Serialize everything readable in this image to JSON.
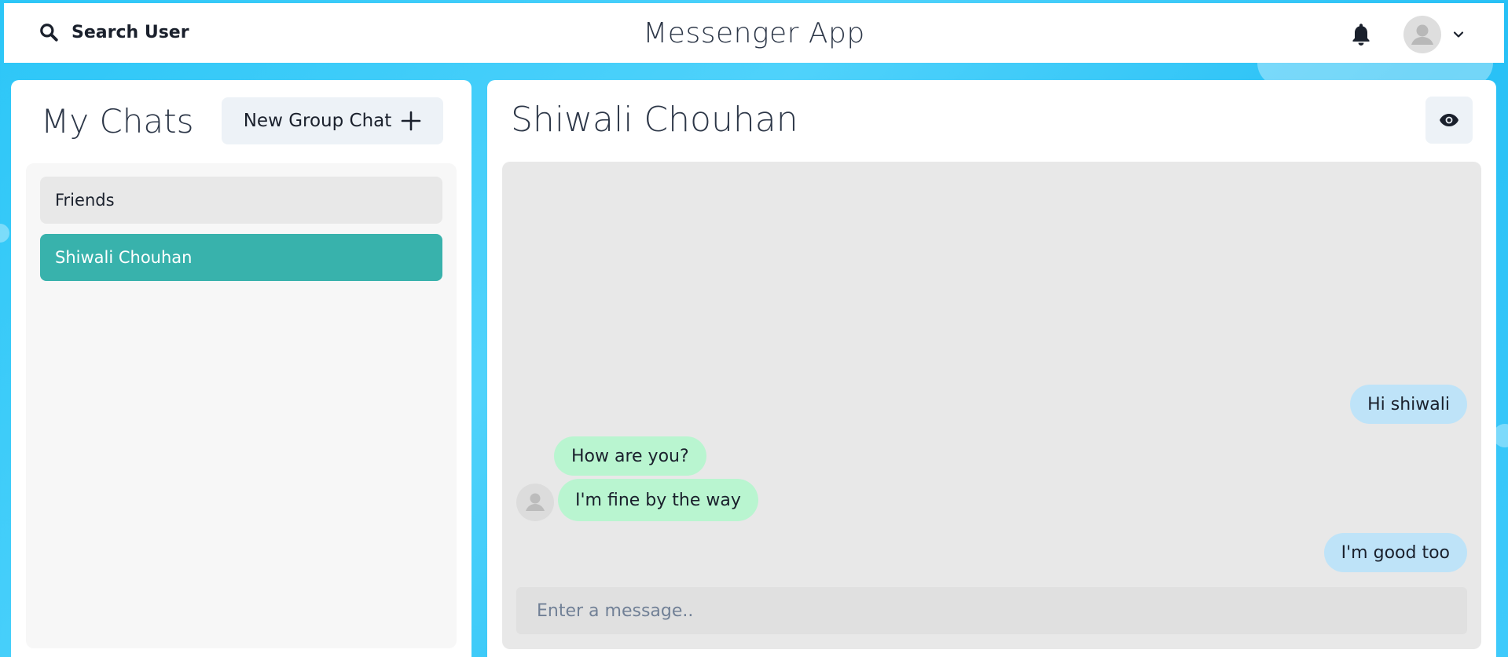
{
  "topbar": {
    "search_label": "Search User",
    "app_title": "Messenger App"
  },
  "icons": {
    "search": "search-icon",
    "notifications": "bell-icon",
    "avatar": "user-avatar-icon",
    "dropdown": "chevron-down-icon",
    "new_group": "plus-icon",
    "view_profile": "eye-icon"
  },
  "sidebar": {
    "title": "My Chats",
    "new_group_label": "New Group Chat",
    "chats": [
      {
        "name": "Friends",
        "active": false
      },
      {
        "name": "Shiwali Chouhan",
        "active": true
      }
    ]
  },
  "chat": {
    "title": "Shiwali Chouhan",
    "messages": [
      {
        "text": "Hi shiwali",
        "from": "me"
      },
      {
        "text": "How are you?",
        "from": "other"
      },
      {
        "text": "I'm fine by the way",
        "from": "other"
      },
      {
        "text": "I'm good too",
        "from": "me"
      }
    ],
    "input_placeholder": "Enter a message.."
  },
  "colors": {
    "background": "#2cc6f7",
    "active_chat": "#38b2ac",
    "sent_bubble": "#bee3f8",
    "received_bubble": "#b9f5d0",
    "panel": "#ffffff"
  }
}
